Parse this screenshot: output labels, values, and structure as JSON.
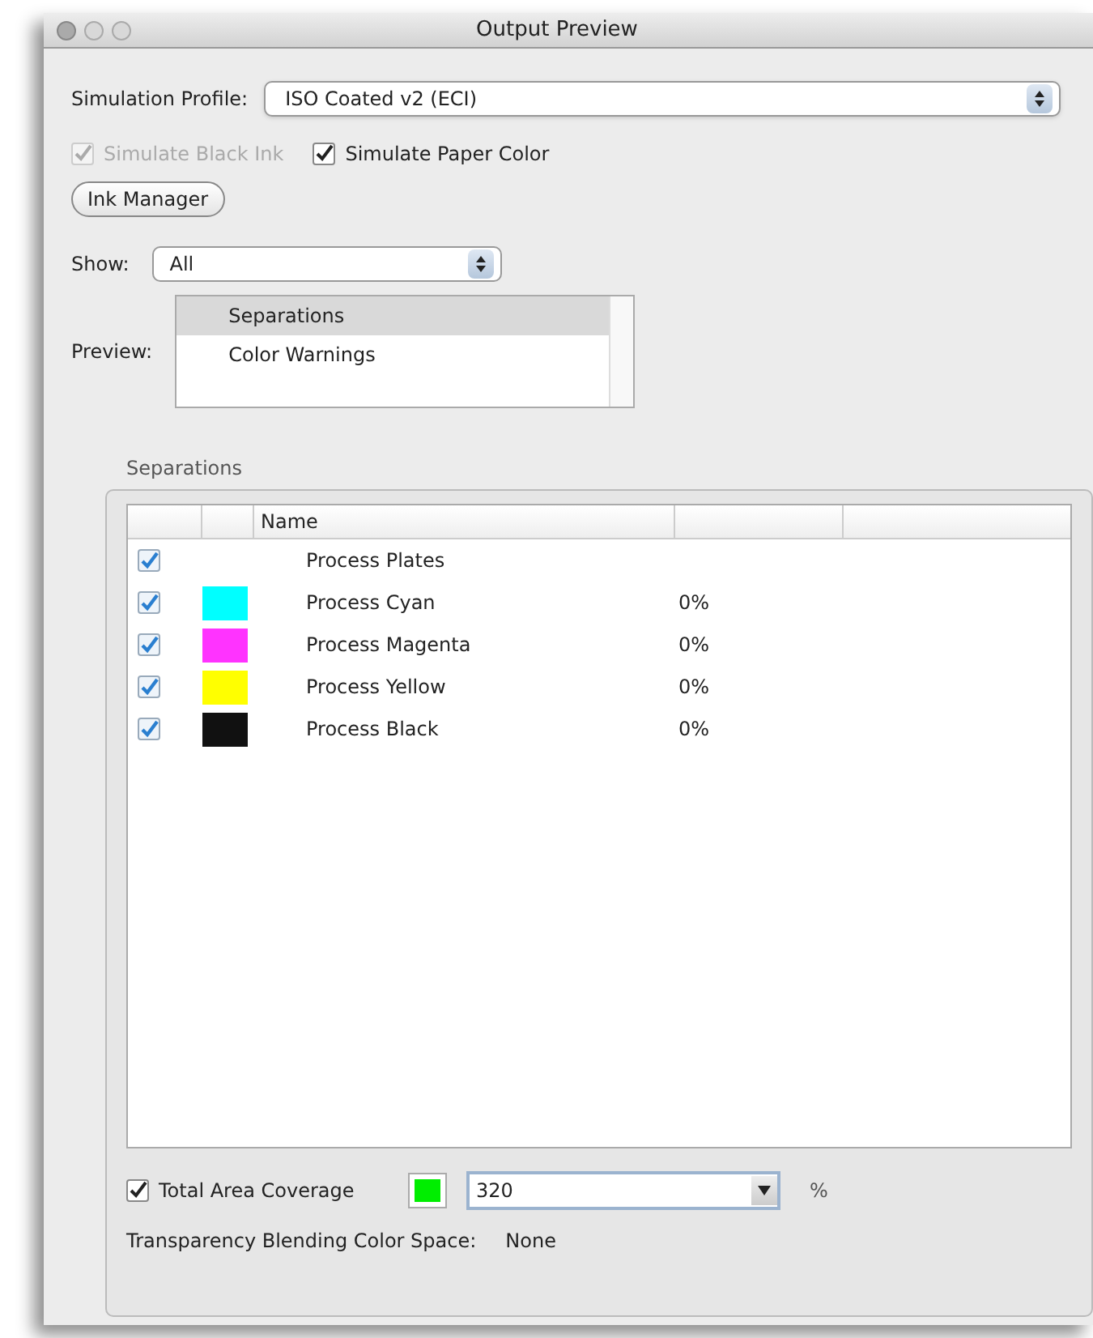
{
  "window": {
    "title": "Output Preview"
  },
  "simulation_profile": {
    "label": "Simulation Profile:",
    "value": "ISO Coated v2 (ECI)"
  },
  "options": [
    {
      "label": "Simulate Black Ink",
      "checked": true,
      "disabled": true
    },
    {
      "label": "Simulate Paper Color",
      "checked": true,
      "disabled": false
    }
  ],
  "ink_manager_button": "Ink Manager",
  "show": {
    "label": "Show:",
    "value": "All"
  },
  "preview": {
    "label": "Preview:",
    "items": [
      {
        "label": "Separations",
        "selected": true
      },
      {
        "label": "Color Warnings",
        "selected": false
      }
    ]
  },
  "separations": {
    "title": "Separations",
    "columns": [
      "Name"
    ],
    "rows": [
      {
        "name": "Process Plates",
        "checked": true
      },
      {
        "name": "Process Cyan",
        "checked": true,
        "color": "#00ffff",
        "coverage": "0%"
      },
      {
        "name": "Process Magenta",
        "checked": true,
        "color": "#ff33ff",
        "coverage": "0%"
      },
      {
        "name": "Process Yellow",
        "checked": true,
        "color": "#ffff00",
        "coverage": "0%"
      },
      {
        "name": "Process Black",
        "checked": true,
        "color": "#111111",
        "coverage": "0%"
      }
    ],
    "total_area_coverage": {
      "label": "Total Area Coverage",
      "checked": true,
      "color": "#00ee00",
      "value": "320",
      "unit": "%"
    },
    "blending": {
      "label": "Transparency Blending Color Space:",
      "value": "None"
    }
  }
}
